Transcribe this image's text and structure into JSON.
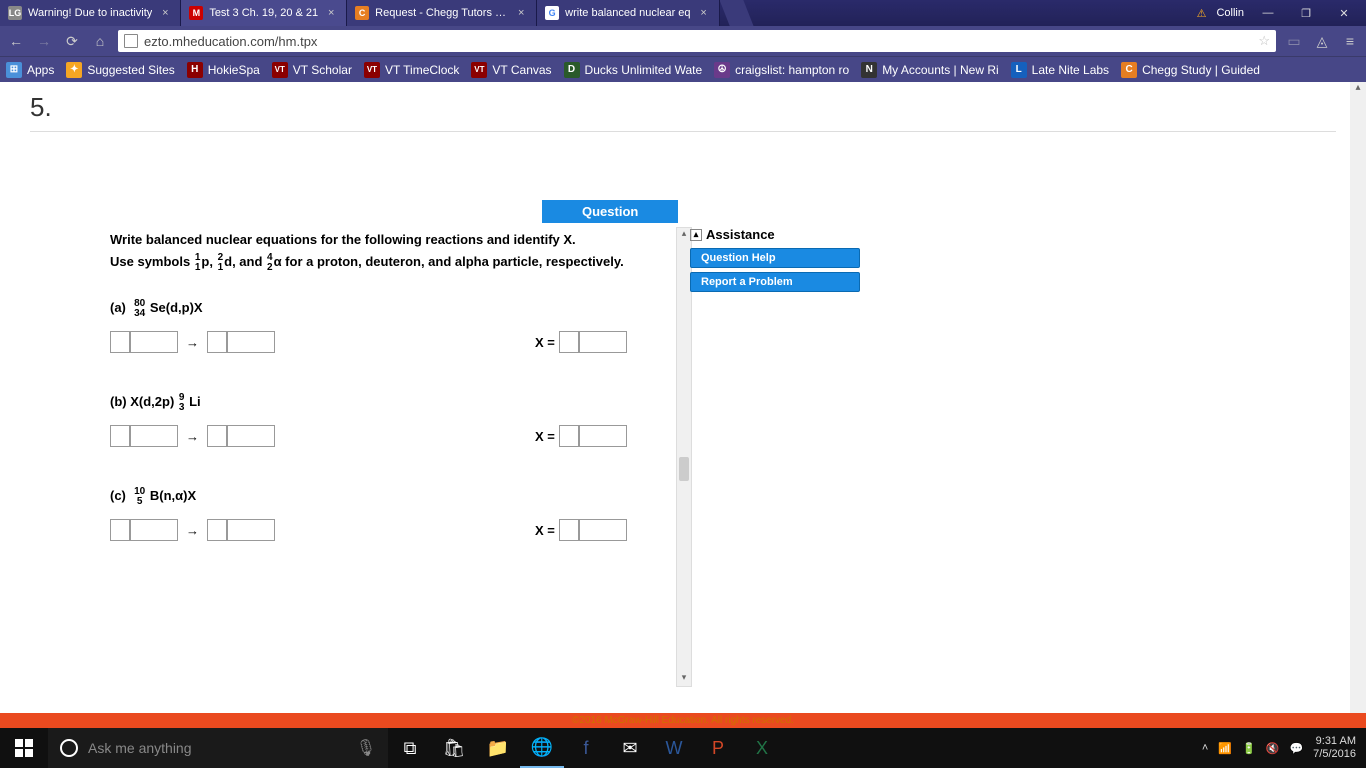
{
  "tabs": [
    {
      "favicon_bg": "#888",
      "favicon_text": "LG",
      "title": "Warning! Due to inactivity"
    },
    {
      "favicon_bg": "#c00",
      "favicon_text": "M",
      "title": "Test 3 Ch. 19, 20 & 21"
    },
    {
      "favicon_bg": "#e67e22",
      "favicon_text": "C",
      "title": "Request - Chegg Tutors | O"
    },
    {
      "favicon_bg": "#fff",
      "favicon_text": "G",
      "title": "write balanced nuclear eq"
    }
  ],
  "user_name": "Collin",
  "url": "ezto.mheducation.com/hm.tpx",
  "bookmarks": [
    {
      "icon_bg": "#4a90d9",
      "icon_text": "⊞",
      "label": "Apps"
    },
    {
      "icon_bg": "#f5a623",
      "icon_text": "✦",
      "label": "Suggested Sites"
    },
    {
      "icon_bg": "#8b0000",
      "icon_text": "H",
      "label": "HokieSpa"
    },
    {
      "icon_bg": "#8b0000",
      "icon_text": "VT",
      "label": "VT Scholar"
    },
    {
      "icon_bg": "#8b0000",
      "icon_text": "VT",
      "label": "VT TimeClock"
    },
    {
      "icon_bg": "#8b0000",
      "icon_text": "VT",
      "label": "VT Canvas"
    },
    {
      "icon_bg": "#2a5a2a",
      "icon_text": "D",
      "label": "Ducks Unlimited Wate"
    },
    {
      "icon_bg": "#6a3a8a",
      "icon_text": "☮",
      "label": "craigslist: hampton ro"
    },
    {
      "icon_bg": "#333",
      "icon_text": "N",
      "label": "My Accounts | New Ri"
    },
    {
      "icon_bg": "#1560bd",
      "icon_text": "L",
      "label": "Late Nite Labs"
    },
    {
      "icon_bg": "#e67e22",
      "icon_text": "C",
      "label": "Chegg Study | Guided"
    }
  ],
  "q_number": "5.",
  "question_tab": "Question",
  "q_line1": "Write balanced nuclear equations for the following reactions and identify X.",
  "q_line2_prefix": "Use symbols ",
  "q_line2_mid1": "p, ",
  "q_line2_mid2": "d, and ",
  "q_line2_suffix": "α for a proton, deuteron, and alpha particle, respectively.",
  "symbols": {
    "p": {
      "top": "1",
      "bot": "1"
    },
    "d": {
      "top": "2",
      "bot": "1"
    },
    "a": {
      "top": "4",
      "bot": "2"
    }
  },
  "parts": [
    {
      "label": "(a)",
      "iso_top": "80",
      "iso_bot": "34",
      "nucl": " Se(d,p)X"
    },
    {
      "label": "(b)",
      "pretext": "X(d,2p) ",
      "iso_top": "9",
      "iso_bot": "3",
      "nucl": "Li"
    },
    {
      "label": "(c)",
      "iso_top": "10",
      "iso_bot": "5",
      "nucl": " B(n,α)X"
    }
  ],
  "arrow": "→",
  "x_equals": "X =",
  "assist": {
    "title": "Assistance",
    "help": "Question Help",
    "report": "Report a Problem"
  },
  "footer": "©2016 McGraw-Hill Education. All rights reserved.",
  "cortana": "Ask me anything",
  "clock": {
    "time": "9:31 AM",
    "date": "7/5/2016"
  }
}
